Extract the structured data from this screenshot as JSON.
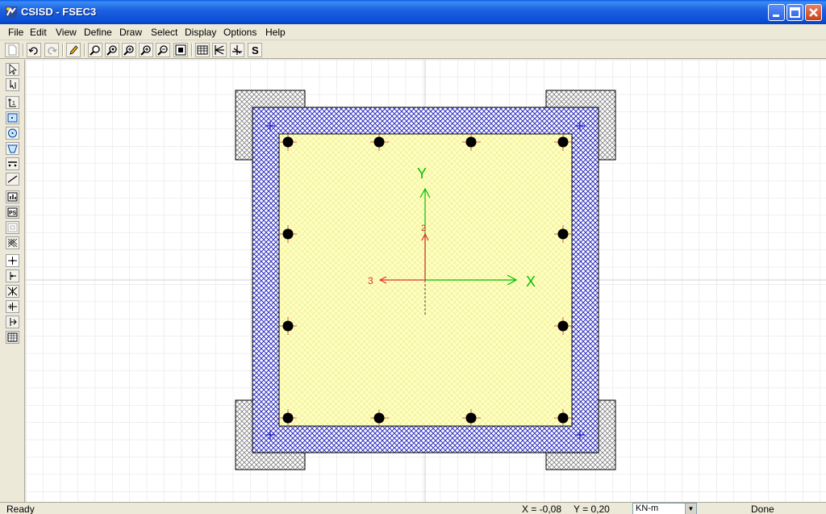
{
  "window": {
    "title": "CSISD - FSEC3"
  },
  "menu": {
    "items": [
      "File",
      "Edit",
      "View",
      "Define",
      "Draw",
      "Select",
      "Display",
      "Options",
      "Help"
    ]
  },
  "canvas": {
    "axes": {
      "global_y_label": "Y",
      "global_x_label": "X",
      "local_2_label": "2",
      "local_3_label": "3"
    }
  },
  "statusbar": {
    "ready": "Ready",
    "x_readout": "X = -0,08",
    "y_readout": "Y = 0,20",
    "units": "KN-m",
    "done": "Done"
  },
  "colors": {
    "concrete_fill": "#FFFFC8",
    "confinement_steel": "#3030C0",
    "plate_hatch": "#808080",
    "rebar": "#000000",
    "axis_global": "#00C000",
    "axis_local": "#E03030"
  }
}
